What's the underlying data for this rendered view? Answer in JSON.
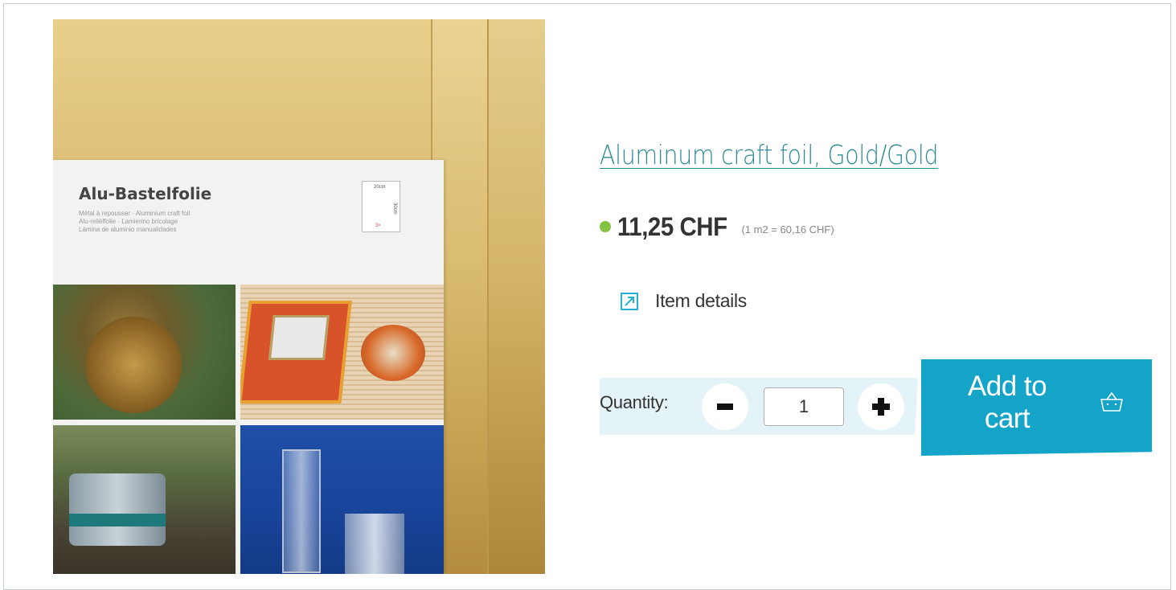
{
  "product": {
    "name": "Aluminum craft foil, Gold/Gold",
    "price": "11,25 CHF",
    "unit_price": "(1 m2 = 60,16 CHF)",
    "in_stock_color": "#84c341",
    "details_label": "Item details"
  },
  "image": {
    "card_title": "Alu-Bastelfolie",
    "card_lines": [
      "Métal à repousser · Aluminium craft foil",
      "Alu-reliëffolie · Lamierino bricolage",
      "Lámina de aluminio manualidades"
    ],
    "size_width": "20cm",
    "size_height": "30cm",
    "count": "3×"
  },
  "quantity": {
    "label": "Quantity:",
    "value": "1",
    "minus_icon": "minus-icon",
    "plus_icon": "plus-icon"
  },
  "cart": {
    "label_line1": "Add to",
    "label_line2": "cart",
    "icon": "basket-icon"
  },
  "colors": {
    "link": "#2d8a94",
    "accent": "#14a4c7",
    "panel": "#e4f3f8"
  }
}
